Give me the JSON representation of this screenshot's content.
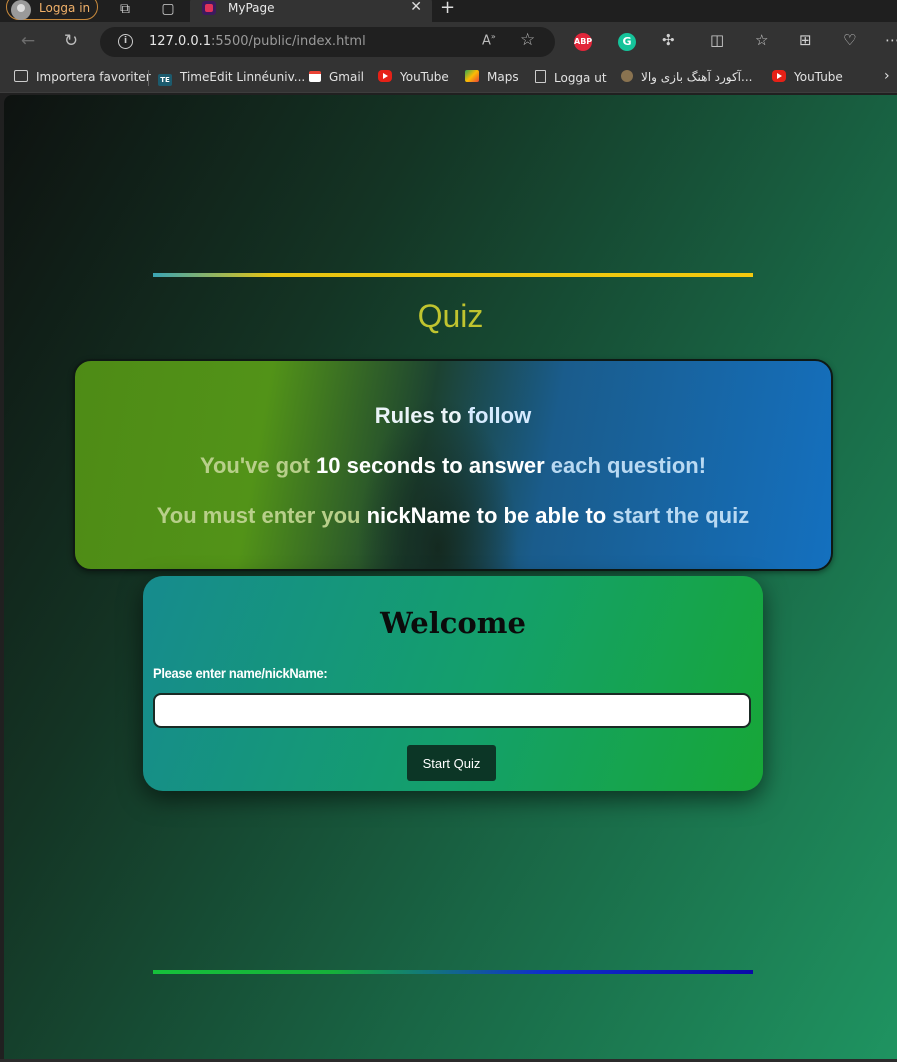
{
  "browser": {
    "profile_label": "Logga in",
    "tab_title": "MyPage",
    "address_host": "127.0.0.1",
    "address_rest": ":5500/public/index.html",
    "read_aloud_glyph": "A",
    "extensions": {
      "abp": "ABP",
      "grammarly": "G"
    },
    "bookmarks": [
      "Importera favoriter",
      "TimeEdit Linnéuniv...",
      "Gmail",
      "YouTube",
      "Maps",
      "Logga ut",
      "آکورد آهنگ بازی والا...",
      "YouTube"
    ]
  },
  "page": {
    "title": "Quiz",
    "rules": {
      "heading_a": "Rules to ",
      "heading_b": "follow",
      "line1_a": "You've got ",
      "line1_b": "10 seconds to answer",
      "line1_c": " each question!",
      "line2_a": "You must enter you ",
      "line2_b": "nickName to be able to",
      "line2_c": " start the quiz"
    },
    "welcome": {
      "heading": "Welcome",
      "label": "Please enter name/nickName:",
      "input_value": "",
      "button": "Start Quiz"
    }
  },
  "colors": {
    "title": "#c0c42f",
    "start_button": "#0c3626",
    "top_line": "#f3c90e",
    "bottom_line": "#0a0aa8"
  }
}
